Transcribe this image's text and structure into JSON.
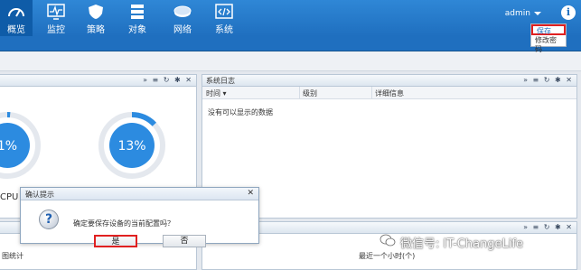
{
  "nav": {
    "items": [
      {
        "label": "概览",
        "icon": "gauge-icon",
        "active": true
      },
      {
        "label": "监控",
        "icon": "monitor-icon"
      },
      {
        "label": "策略",
        "icon": "shield-icon"
      },
      {
        "label": "对象",
        "icon": "server-icon"
      },
      {
        "label": "网络",
        "icon": "router-icon"
      },
      {
        "label": "系统",
        "icon": "code-icon"
      }
    ],
    "user": "admin",
    "info": "i"
  },
  "user_menu": {
    "save": "保存",
    "change_password": "修改密码"
  },
  "panel_tools": {
    "collapse": "»",
    "list": "≡",
    "refresh": "↻",
    "settings": "✱",
    "close": "✕"
  },
  "status_panel": {
    "gauges": [
      {
        "label": "1%",
        "percent": 1
      },
      {
        "label": "13%",
        "percent": 13
      }
    ],
    "cpu_label": "CPU"
  },
  "log_panel": {
    "title": "系统日志",
    "columns": [
      "时间",
      "级别",
      "详细信息"
    ],
    "empty": "没有可以显示的数据"
  },
  "dialog": {
    "title": "确认提示",
    "close": "✕",
    "icon": "?",
    "message": "确定要保存设备的当前配置吗？",
    "yes": "是",
    "no": "否"
  },
  "bottom": {
    "left_text": "图统计",
    "right_text": "最近一个小时(个)"
  },
  "watermark": "微信号: IT-ChangeLife",
  "colors": {
    "nav_bg": "#1f6fbf",
    "gauge": "#2c8be0",
    "highlight": "#e02020"
  }
}
